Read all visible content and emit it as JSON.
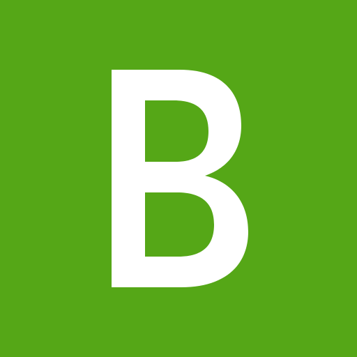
{
  "icon": {
    "letter": "B",
    "background_color": "#55a717",
    "letter_color": "#ffffff"
  }
}
